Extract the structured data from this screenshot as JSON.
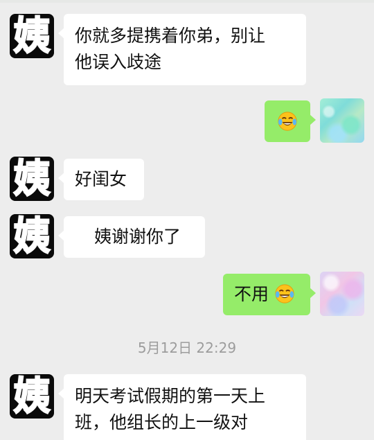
{
  "messages": [
    {
      "sender": "姨",
      "side": "left",
      "text": "你就多提携着你弟，别让他误入歧途",
      "line1": "你就多提携着你弟，别让",
      "line2": "他误入歧途"
    },
    {
      "side": "right",
      "emoji": "crying-laughing-emoji"
    },
    {
      "sender": "姨",
      "side": "left",
      "text": "好闺女"
    },
    {
      "sender": "姨",
      "side": "left",
      "text": "姨谢谢你了"
    },
    {
      "side": "right",
      "text": "不用",
      "emoji": "crying-laughing-emoji"
    },
    {
      "sender": "姨",
      "side": "left",
      "line1": "明天考试假期的第一天上",
      "line2": "班，他组长的上一级对"
    }
  ],
  "timestamp": "5月12日 22:29",
  "avatar_glyph": "姨",
  "colors": {
    "background": "#ededed",
    "left_bubble": "#ffffff",
    "right_bubble": "#95ec69",
    "avatar_bg": "#0a0a0a",
    "timestamp_text": "#9c9c9c"
  }
}
